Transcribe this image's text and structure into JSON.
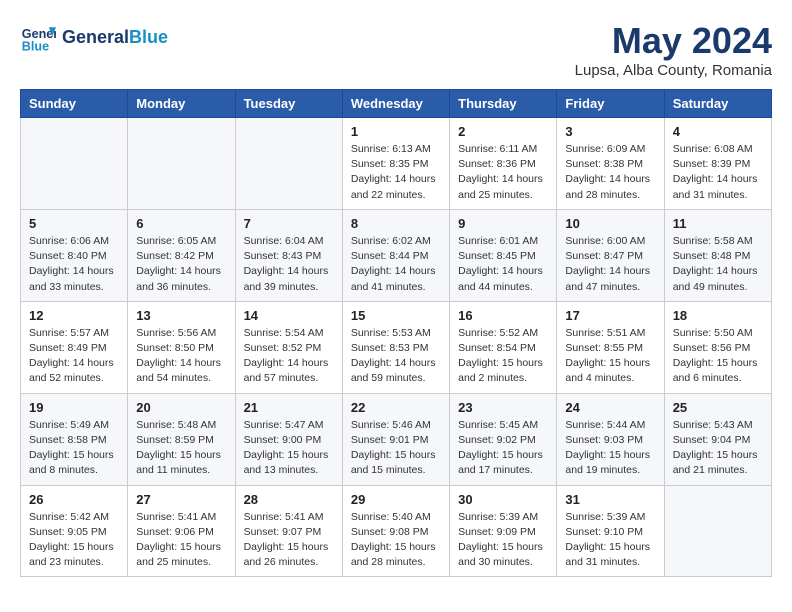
{
  "header": {
    "logo_line1": "General",
    "logo_line2": "Blue",
    "month_title": "May 2024",
    "subtitle": "Lupsa, Alba County, Romania"
  },
  "days_of_week": [
    "Sunday",
    "Monday",
    "Tuesday",
    "Wednesday",
    "Thursday",
    "Friday",
    "Saturday"
  ],
  "weeks": [
    [
      {
        "day": "",
        "info": ""
      },
      {
        "day": "",
        "info": ""
      },
      {
        "day": "",
        "info": ""
      },
      {
        "day": "1",
        "info": "Sunrise: 6:13 AM\nSunset: 8:35 PM\nDaylight: 14 hours\nand 22 minutes."
      },
      {
        "day": "2",
        "info": "Sunrise: 6:11 AM\nSunset: 8:36 PM\nDaylight: 14 hours\nand 25 minutes."
      },
      {
        "day": "3",
        "info": "Sunrise: 6:09 AM\nSunset: 8:38 PM\nDaylight: 14 hours\nand 28 minutes."
      },
      {
        "day": "4",
        "info": "Sunrise: 6:08 AM\nSunset: 8:39 PM\nDaylight: 14 hours\nand 31 minutes."
      }
    ],
    [
      {
        "day": "5",
        "info": "Sunrise: 6:06 AM\nSunset: 8:40 PM\nDaylight: 14 hours\nand 33 minutes."
      },
      {
        "day": "6",
        "info": "Sunrise: 6:05 AM\nSunset: 8:42 PM\nDaylight: 14 hours\nand 36 minutes."
      },
      {
        "day": "7",
        "info": "Sunrise: 6:04 AM\nSunset: 8:43 PM\nDaylight: 14 hours\nand 39 minutes."
      },
      {
        "day": "8",
        "info": "Sunrise: 6:02 AM\nSunset: 8:44 PM\nDaylight: 14 hours\nand 41 minutes."
      },
      {
        "day": "9",
        "info": "Sunrise: 6:01 AM\nSunset: 8:45 PM\nDaylight: 14 hours\nand 44 minutes."
      },
      {
        "day": "10",
        "info": "Sunrise: 6:00 AM\nSunset: 8:47 PM\nDaylight: 14 hours\nand 47 minutes."
      },
      {
        "day": "11",
        "info": "Sunrise: 5:58 AM\nSunset: 8:48 PM\nDaylight: 14 hours\nand 49 minutes."
      }
    ],
    [
      {
        "day": "12",
        "info": "Sunrise: 5:57 AM\nSunset: 8:49 PM\nDaylight: 14 hours\nand 52 minutes."
      },
      {
        "day": "13",
        "info": "Sunrise: 5:56 AM\nSunset: 8:50 PM\nDaylight: 14 hours\nand 54 minutes."
      },
      {
        "day": "14",
        "info": "Sunrise: 5:54 AM\nSunset: 8:52 PM\nDaylight: 14 hours\nand 57 minutes."
      },
      {
        "day": "15",
        "info": "Sunrise: 5:53 AM\nSunset: 8:53 PM\nDaylight: 14 hours\nand 59 minutes."
      },
      {
        "day": "16",
        "info": "Sunrise: 5:52 AM\nSunset: 8:54 PM\nDaylight: 15 hours\nand 2 minutes."
      },
      {
        "day": "17",
        "info": "Sunrise: 5:51 AM\nSunset: 8:55 PM\nDaylight: 15 hours\nand 4 minutes."
      },
      {
        "day": "18",
        "info": "Sunrise: 5:50 AM\nSunset: 8:56 PM\nDaylight: 15 hours\nand 6 minutes."
      }
    ],
    [
      {
        "day": "19",
        "info": "Sunrise: 5:49 AM\nSunset: 8:58 PM\nDaylight: 15 hours\nand 8 minutes."
      },
      {
        "day": "20",
        "info": "Sunrise: 5:48 AM\nSunset: 8:59 PM\nDaylight: 15 hours\nand 11 minutes."
      },
      {
        "day": "21",
        "info": "Sunrise: 5:47 AM\nSunset: 9:00 PM\nDaylight: 15 hours\nand 13 minutes."
      },
      {
        "day": "22",
        "info": "Sunrise: 5:46 AM\nSunset: 9:01 PM\nDaylight: 15 hours\nand 15 minutes."
      },
      {
        "day": "23",
        "info": "Sunrise: 5:45 AM\nSunset: 9:02 PM\nDaylight: 15 hours\nand 17 minutes."
      },
      {
        "day": "24",
        "info": "Sunrise: 5:44 AM\nSunset: 9:03 PM\nDaylight: 15 hours\nand 19 minutes."
      },
      {
        "day": "25",
        "info": "Sunrise: 5:43 AM\nSunset: 9:04 PM\nDaylight: 15 hours\nand 21 minutes."
      }
    ],
    [
      {
        "day": "26",
        "info": "Sunrise: 5:42 AM\nSunset: 9:05 PM\nDaylight: 15 hours\nand 23 minutes."
      },
      {
        "day": "27",
        "info": "Sunrise: 5:41 AM\nSunset: 9:06 PM\nDaylight: 15 hours\nand 25 minutes."
      },
      {
        "day": "28",
        "info": "Sunrise: 5:41 AM\nSunset: 9:07 PM\nDaylight: 15 hours\nand 26 minutes."
      },
      {
        "day": "29",
        "info": "Sunrise: 5:40 AM\nSunset: 9:08 PM\nDaylight: 15 hours\nand 28 minutes."
      },
      {
        "day": "30",
        "info": "Sunrise: 5:39 AM\nSunset: 9:09 PM\nDaylight: 15 hours\nand 30 minutes."
      },
      {
        "day": "31",
        "info": "Sunrise: 5:39 AM\nSunset: 9:10 PM\nDaylight: 15 hours\nand 31 minutes."
      },
      {
        "day": "",
        "info": ""
      }
    ]
  ]
}
